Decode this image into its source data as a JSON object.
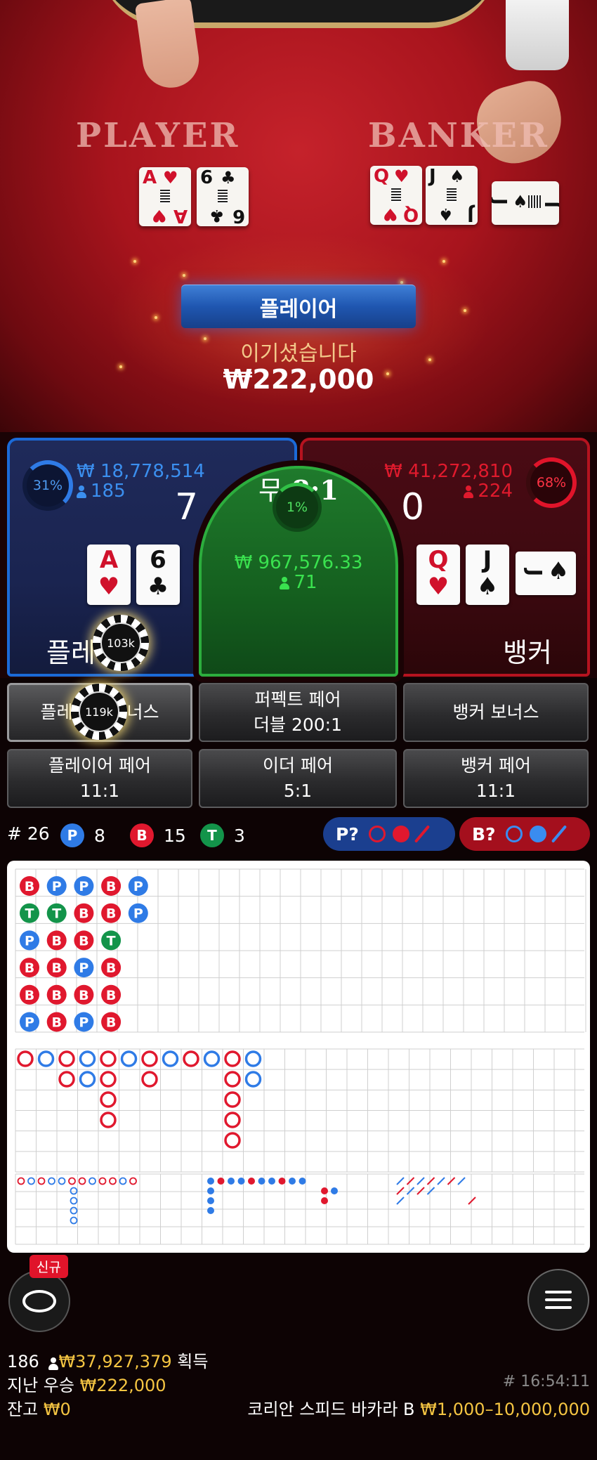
{
  "table": {
    "player_label": "PLAYER",
    "banker_label": "BANKER",
    "player_cards": [
      {
        "rank": "A",
        "suit": "♥",
        "color": "red"
      },
      {
        "rank": "6",
        "suit": "♣",
        "color": "black"
      }
    ],
    "banker_cards": [
      {
        "rank": "Q",
        "suit": "♥",
        "color": "red"
      },
      {
        "rank": "J",
        "suit": "♠",
        "color": "black"
      },
      {
        "rank": "J",
        "suit": "♠",
        "color": "black"
      }
    ],
    "result_banner": "플레이어",
    "win_text": "이기셨습니다",
    "win_amount": "₩222,000"
  },
  "bets": {
    "player": {
      "percent": "31%",
      "amount": "₩ 18,778,514",
      "count": "185",
      "score": "7",
      "label": "플레이어",
      "chip": "103k",
      "cards": [
        {
          "rank": "A",
          "suit": "♥",
          "color": "red"
        },
        {
          "rank": "6",
          "suit": "♣",
          "color": "black"
        }
      ]
    },
    "tie": {
      "percent": "1%",
      "amount": "₩ 967,576.33",
      "count": "71",
      "label": "무",
      "payout": "8:1"
    },
    "banker": {
      "percent": "68%",
      "amount": "₩ 41,272,810",
      "count": "224",
      "score": "0",
      "label": "뱅커",
      "cards": [
        {
          "rank": "Q",
          "suit": "♥",
          "color": "red"
        },
        {
          "rank": "J",
          "suit": "♠",
          "color": "black"
        },
        {
          "rank": "J",
          "suit": "♠",
          "color": "black"
        }
      ]
    }
  },
  "side_bets": {
    "player_bonus": "플레이어 보너스",
    "player_bonus_chip": "119k",
    "perfect_pair": "퍼펙트 페어",
    "perfect_pair_payout": "더블 200:1",
    "banker_bonus": "뱅커 보너스",
    "player_pair": "플레이어 페어",
    "player_pair_payout": "11:1",
    "either_pair": "이더 페어",
    "either_pair_payout": "5:1",
    "banker_pair": "뱅커 페어",
    "banker_pair_payout": "11:1"
  },
  "stats": {
    "round_label": "# 26",
    "p_letter": "P",
    "p_count": "8",
    "b_letter": "B",
    "b_count": "15",
    "t_letter": "T",
    "t_count": "3",
    "predict_player": "P?",
    "predict_banker": "B?"
  },
  "roadmap": {
    "colors": {
      "player": "#2f7be6",
      "banker": "#e0182e",
      "tie": "#13944a"
    },
    "bead_plate": [
      [
        "B",
        "T",
        "P",
        "B",
        "B",
        "P"
      ],
      [
        "P",
        "T",
        "B",
        "B",
        "B",
        "B"
      ],
      [
        "P",
        "B",
        "B",
        "P",
        "B",
        "P"
      ],
      [
        "B",
        "B",
        "T",
        "B",
        "B",
        "B"
      ],
      [
        "P",
        "P"
      ]
    ]
  },
  "footer": {
    "new_badge": "신규",
    "players": "186",
    "total_won": "₩37,927,379",
    "total_won_suffix": "획득",
    "last_win_label": "지난 우승",
    "last_win": "₩222,000",
    "time": "# 16:54:11",
    "balance_label": "잔고",
    "balance": "₩0",
    "table_name": "코리안 스피드 바카라 B",
    "limits": "₩1,000–10,000,000"
  }
}
